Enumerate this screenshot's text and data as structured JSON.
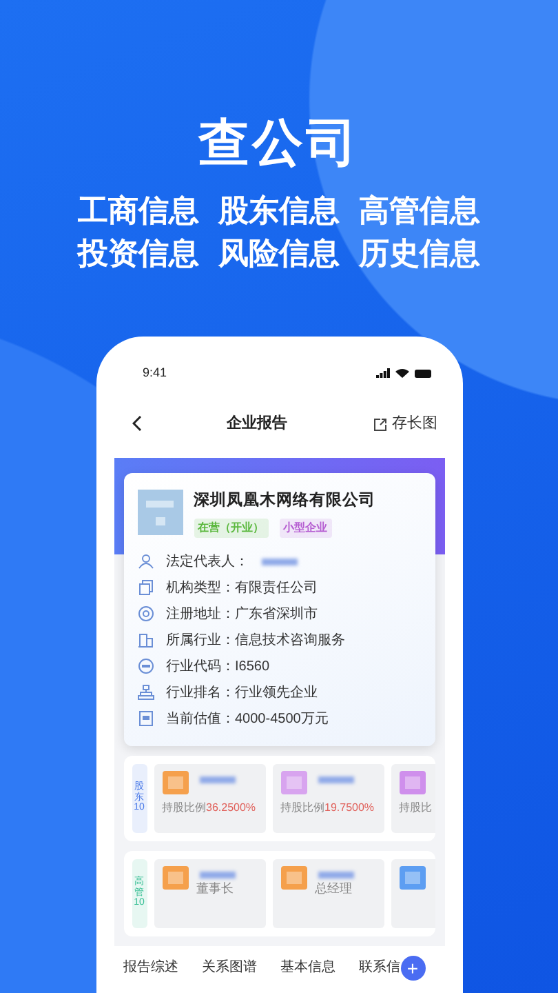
{
  "headline": "查公司",
  "features": [
    "工商信息",
    "股东信息",
    "高管信息",
    "投资信息",
    "风险信息",
    "历史信息"
  ],
  "phone": {
    "status_time": "9:41",
    "nav_title": "企业报告",
    "nav_action": "存长图",
    "company": {
      "name": "深圳凤凰木网络有限公司",
      "tags": [
        {
          "label": "在营（开业）",
          "color": "#5bb83e"
        },
        {
          "label": "小型企业",
          "color": "#b65fd2"
        }
      ]
    },
    "info_rows": [
      {
        "kind": "person",
        "label": "法定代表人：",
        "blurred": true
      },
      {
        "kind": "copy",
        "label": "机构类型：",
        "value": "有限责任公司"
      },
      {
        "kind": "location",
        "label": "注册地址：",
        "value": "广东省深圳市"
      },
      {
        "kind": "building",
        "label": "所属行业：",
        "value": "信息技术咨询服务"
      },
      {
        "kind": "code",
        "label": "行业代码：",
        "value": "I6560"
      },
      {
        "kind": "org",
        "label": "行业排名：",
        "value": "行业领先企业"
      },
      {
        "kind": "doc",
        "label": "当前估值：",
        "value": "4000-4500万元"
      }
    ],
    "sections": [
      {
        "kind": "shareholders",
        "side_label": "股东",
        "count": "10",
        "color": "#4a7ae8",
        "items": [
          {
            "color": "#f5a04c",
            "caption": "持股比例",
            "value": "36.2500%"
          },
          {
            "color": "#d8a4ef",
            "caption": "持股比例",
            "value": "19.7500%"
          },
          {
            "color": "#cf8fec",
            "caption": "持股比"
          }
        ]
      },
      {
        "kind": "executives",
        "side_label": "高管",
        "count": "10",
        "color": "#38bf95",
        "items": [
          {
            "color": "#f5a04c",
            "caption": "董事长"
          },
          {
            "color": "#f5a04c",
            "caption": "总经理"
          },
          {
            "color": "#5d9ef2"
          }
        ]
      }
    ],
    "tabs": [
      "报告综述",
      "关系图谱",
      "基本信息",
      "联系信"
    ],
    "fab": "+"
  }
}
